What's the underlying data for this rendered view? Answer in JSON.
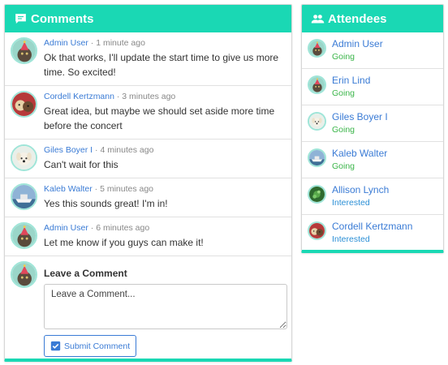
{
  "comments_panel": {
    "title": "Comments",
    "comments": [
      {
        "author": "Admin User",
        "time": "1 minute ago",
        "text": "Ok that works, I'll update the start time to give us more time. So excited!",
        "avatar": "cat-party-hat"
      },
      {
        "author": "Cordell Kertzmann",
        "time": "3 minutes ago",
        "text": "Great idea, but maybe we should set aside more time before the concert",
        "avatar": "dogs-photo"
      },
      {
        "author": "Giles Boyer I",
        "time": "4 minutes ago",
        "text": "Can't wait for this",
        "avatar": "white-dog"
      },
      {
        "author": "Kaleb Walter",
        "time": "5 minutes ago",
        "text": "Yes this sounds great! I'm in!",
        "avatar": "boat-photo"
      },
      {
        "author": "Admin User",
        "time": "6 minutes ago",
        "text": "Let me know if you guys can make it!",
        "avatar": "cat-party-hat"
      }
    ],
    "separator": " · ",
    "leave_title": "Leave a Comment",
    "textarea_placeholder": "Leave a Comment...",
    "submit_label": "Submit Comment"
  },
  "attendees_panel": {
    "title": "Attendees",
    "attendees": [
      {
        "name": "Admin User",
        "status": "Going",
        "avatar": "cat-party-hat"
      },
      {
        "name": "Erin Lind",
        "status": "Going",
        "avatar": "cat-party-hat"
      },
      {
        "name": "Giles Boyer I",
        "status": "Going",
        "avatar": "white-dog"
      },
      {
        "name": "Kaleb Walter",
        "status": "Going",
        "avatar": "boat-photo"
      },
      {
        "name": "Allison Lynch",
        "status": "Interested",
        "avatar": "plant-photo"
      },
      {
        "name": "Cordell Kertzmann",
        "status": "Interested",
        "avatar": "dogs-photo"
      }
    ]
  },
  "colors": {
    "accent": "#1ad8b4",
    "link": "#3a7bd5",
    "going": "#3bb54a",
    "interested": "#2b8fd6"
  }
}
